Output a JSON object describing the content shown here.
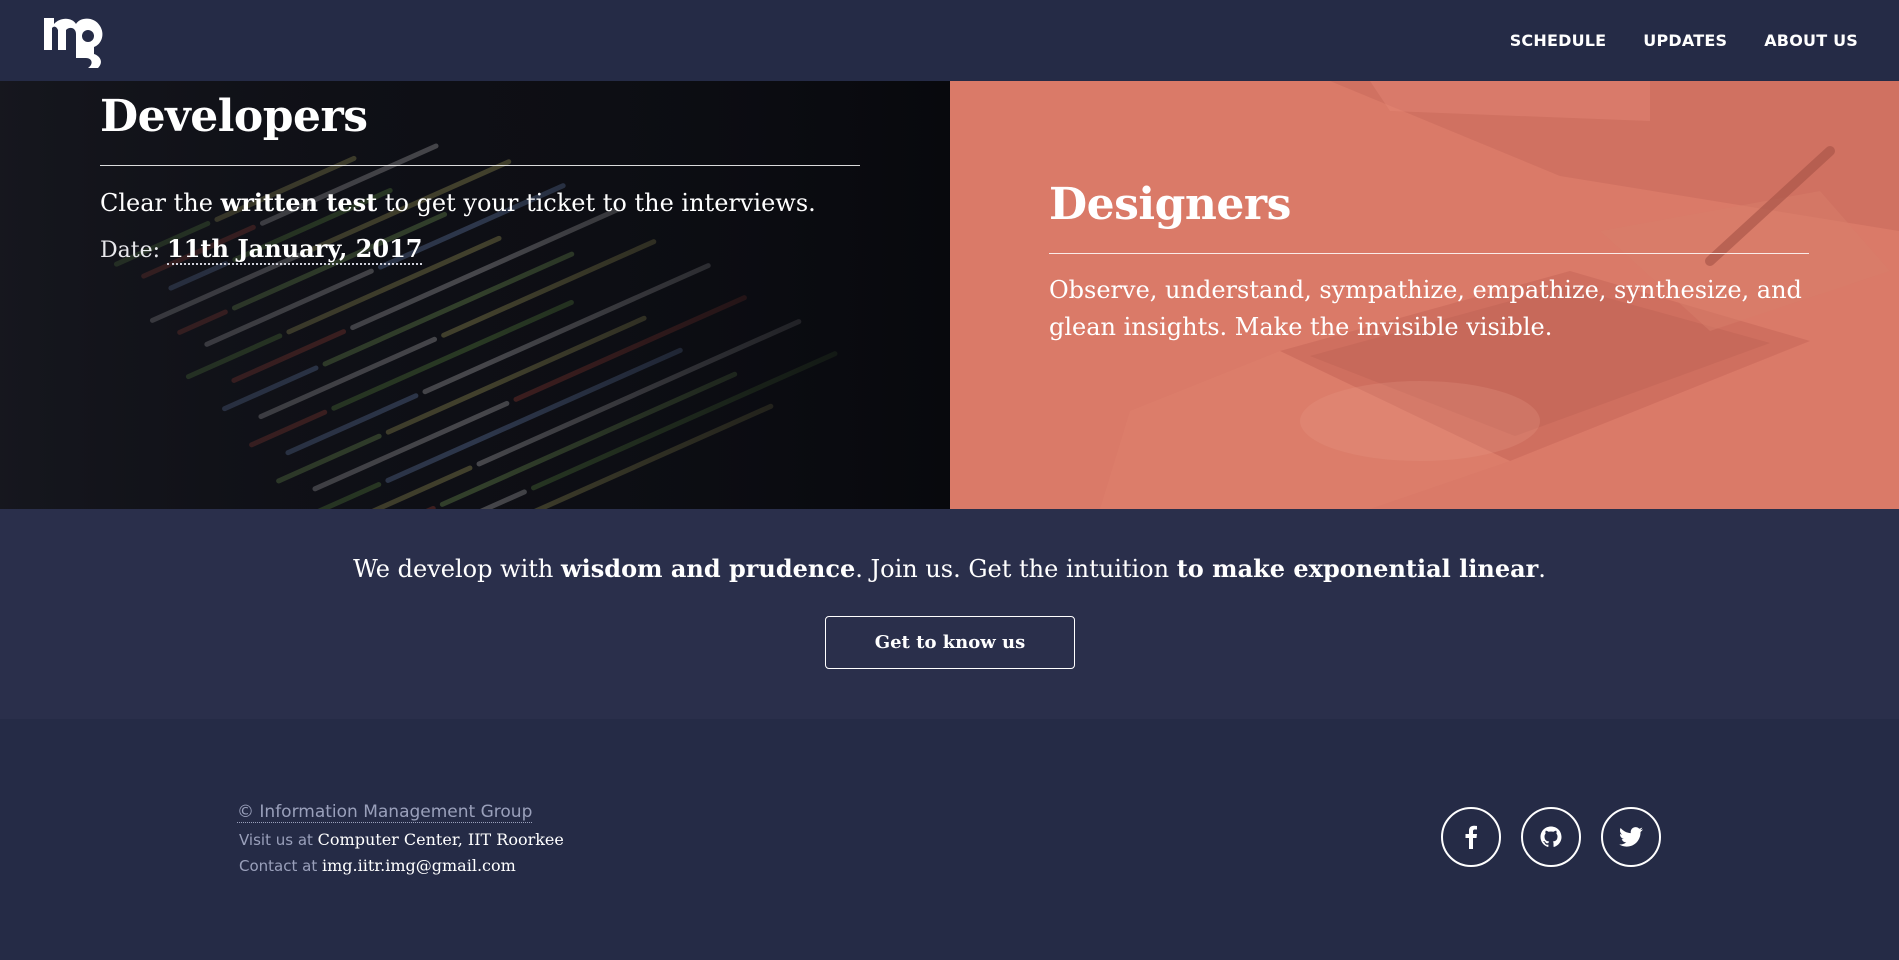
{
  "nav": {
    "logo_icon": "img-logo-icon",
    "links": [
      "SCHEDULE",
      "UPDATES",
      "ABOUT US"
    ]
  },
  "developers": {
    "title": "Developers",
    "text_pre": "Clear the ",
    "text_bold": "written test",
    "text_post": " to get your ticket to the interviews.",
    "date_label": "Date: ",
    "date_value": "11th January, 2017"
  },
  "designers": {
    "title": "Designers",
    "text": "Observe, understand, sympathize, empathize, synthesize, and glean insights. Make the invisible visible."
  },
  "cta": {
    "text_1": "We develop with ",
    "text_2": "wisdom and prudence",
    "text_3": ". Join us. Get the intuition ",
    "text_4": "to make exponential linear",
    "text_5": ".",
    "button_label": "Get to know us"
  },
  "footer": {
    "copyright": "© Information Management Group",
    "visit_label": "Visit us at ",
    "visit_value": "Computer Center, IIT Roorkee",
    "contact_label": "Contact at ",
    "contact_value": "img.iitr.img@gmail.com",
    "social_icons": [
      "facebook-icon",
      "github-icon",
      "twitter-icon"
    ]
  },
  "colors": {
    "nav_bg": "#252b46",
    "cta_bg": "#2a2f4b",
    "developers_bg": "#0e0f15",
    "designers_overlay": "#d97766"
  }
}
